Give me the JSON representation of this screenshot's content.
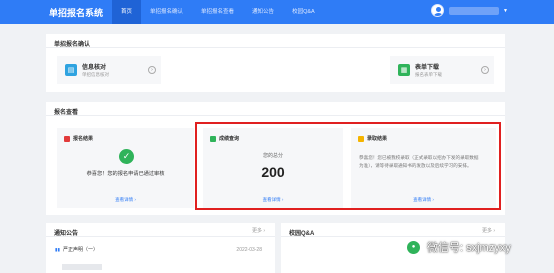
{
  "app": {
    "title": "单招报名系统"
  },
  "nav": [
    {
      "label": "首页",
      "active": true
    },
    {
      "label": "单招报名确认",
      "active": false
    },
    {
      "label": "单招报名查看",
      "active": false
    },
    {
      "label": "通知公告",
      "active": false
    },
    {
      "label": "校园Q&A",
      "active": false
    }
  ],
  "confirm": {
    "title": "单招报名确认",
    "cards": [
      {
        "title": "信息核对",
        "subtitle": "单招信息核对",
        "icon": "id-card-icon",
        "color": "#2fa3e0"
      },
      {
        "title": "表单下载",
        "subtitle": "报名表单下载",
        "icon": "form-download-icon",
        "color": "#2fb35a"
      }
    ]
  },
  "view": {
    "title": "报名查看",
    "result": {
      "title": "报名结果",
      "status": "恭喜您！您的报名申请已通过审核",
      "link": "查看详情 ›",
      "color": "#e23b3b"
    },
    "score": {
      "title": "成绩查询",
      "label": "您的总分",
      "value": "200",
      "link": "查看详情 ›",
      "color": "#2fb35a"
    },
    "admit": {
      "title": "录取结果",
      "note": "恭喜您！您已被我校录取（正式录取以招办下发的录取数据为准），请等待录取通知书的发放以及后续学习的安排。",
      "link": "查看详情 ›",
      "color": "#f5b400"
    }
  },
  "notice": {
    "title": "通知公告",
    "more": "更多 ›",
    "items": [
      {
        "title": "严正声明（一）",
        "date": "2022-03-28"
      }
    ]
  },
  "qa": {
    "title": "校园Q&A",
    "more": "更多 ›"
  },
  "watermark": {
    "text": "微信号: sxjmzyxy"
  }
}
